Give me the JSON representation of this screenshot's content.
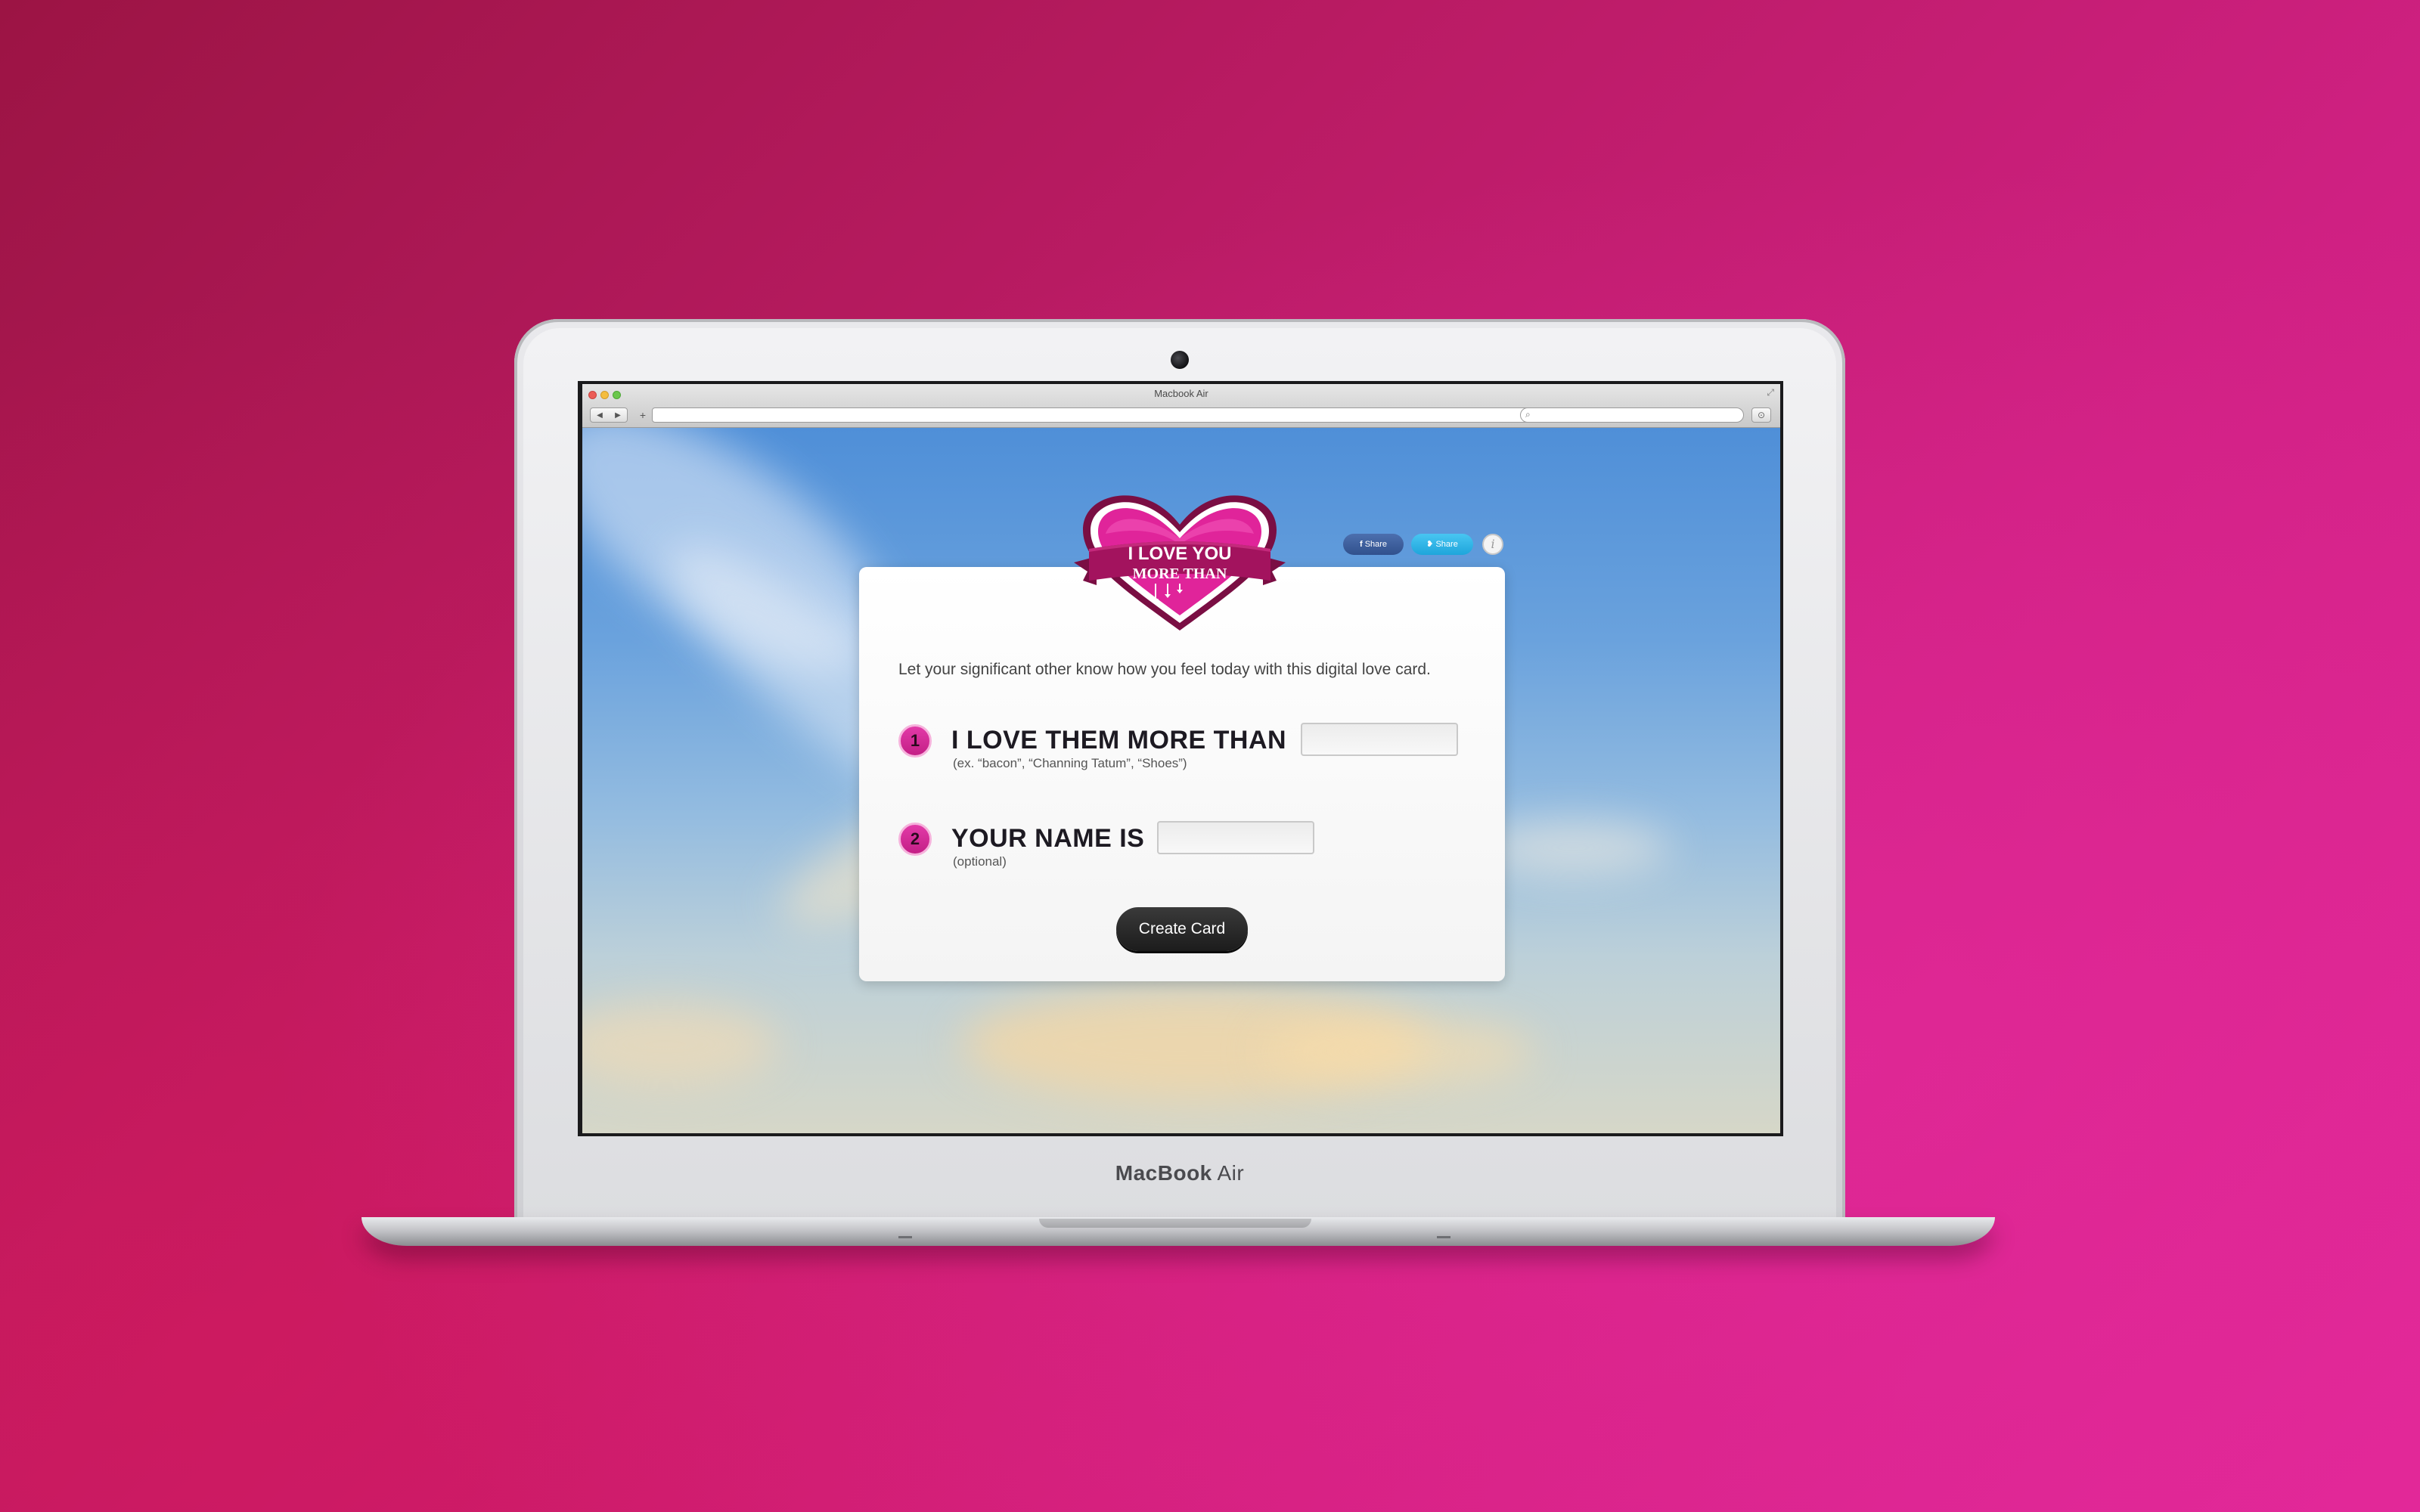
{
  "window": {
    "title": "Macbook Air",
    "url": "",
    "search_value": ""
  },
  "device": {
    "brand_label_bold": "MacBook",
    "brand_label_light": " Air"
  },
  "logo": {
    "line1": "I LOVE YOU",
    "line2": "MORE THAN"
  },
  "social": {
    "facebook_label": "Share",
    "twitter_label": "Share",
    "info_label": "i"
  },
  "card": {
    "intro": "Let your significant other know how you feel today with this digital love card.",
    "steps": [
      {
        "number": "1",
        "label": "I LOVE THEM MORE THAN",
        "hint": "(ex. “bacon”, “Channing Tatum”, “Shoes”)",
        "value": ""
      },
      {
        "number": "2",
        "label": "YOUR NAME IS",
        "hint": "(optional)",
        "value": ""
      }
    ],
    "submit_label": "Create Card"
  },
  "colors": {
    "brand_pink": "#e0249a",
    "button_dark": "#222222",
    "facebook_blue": "#3b5998",
    "twitter_blue": "#2aa9e0"
  }
}
